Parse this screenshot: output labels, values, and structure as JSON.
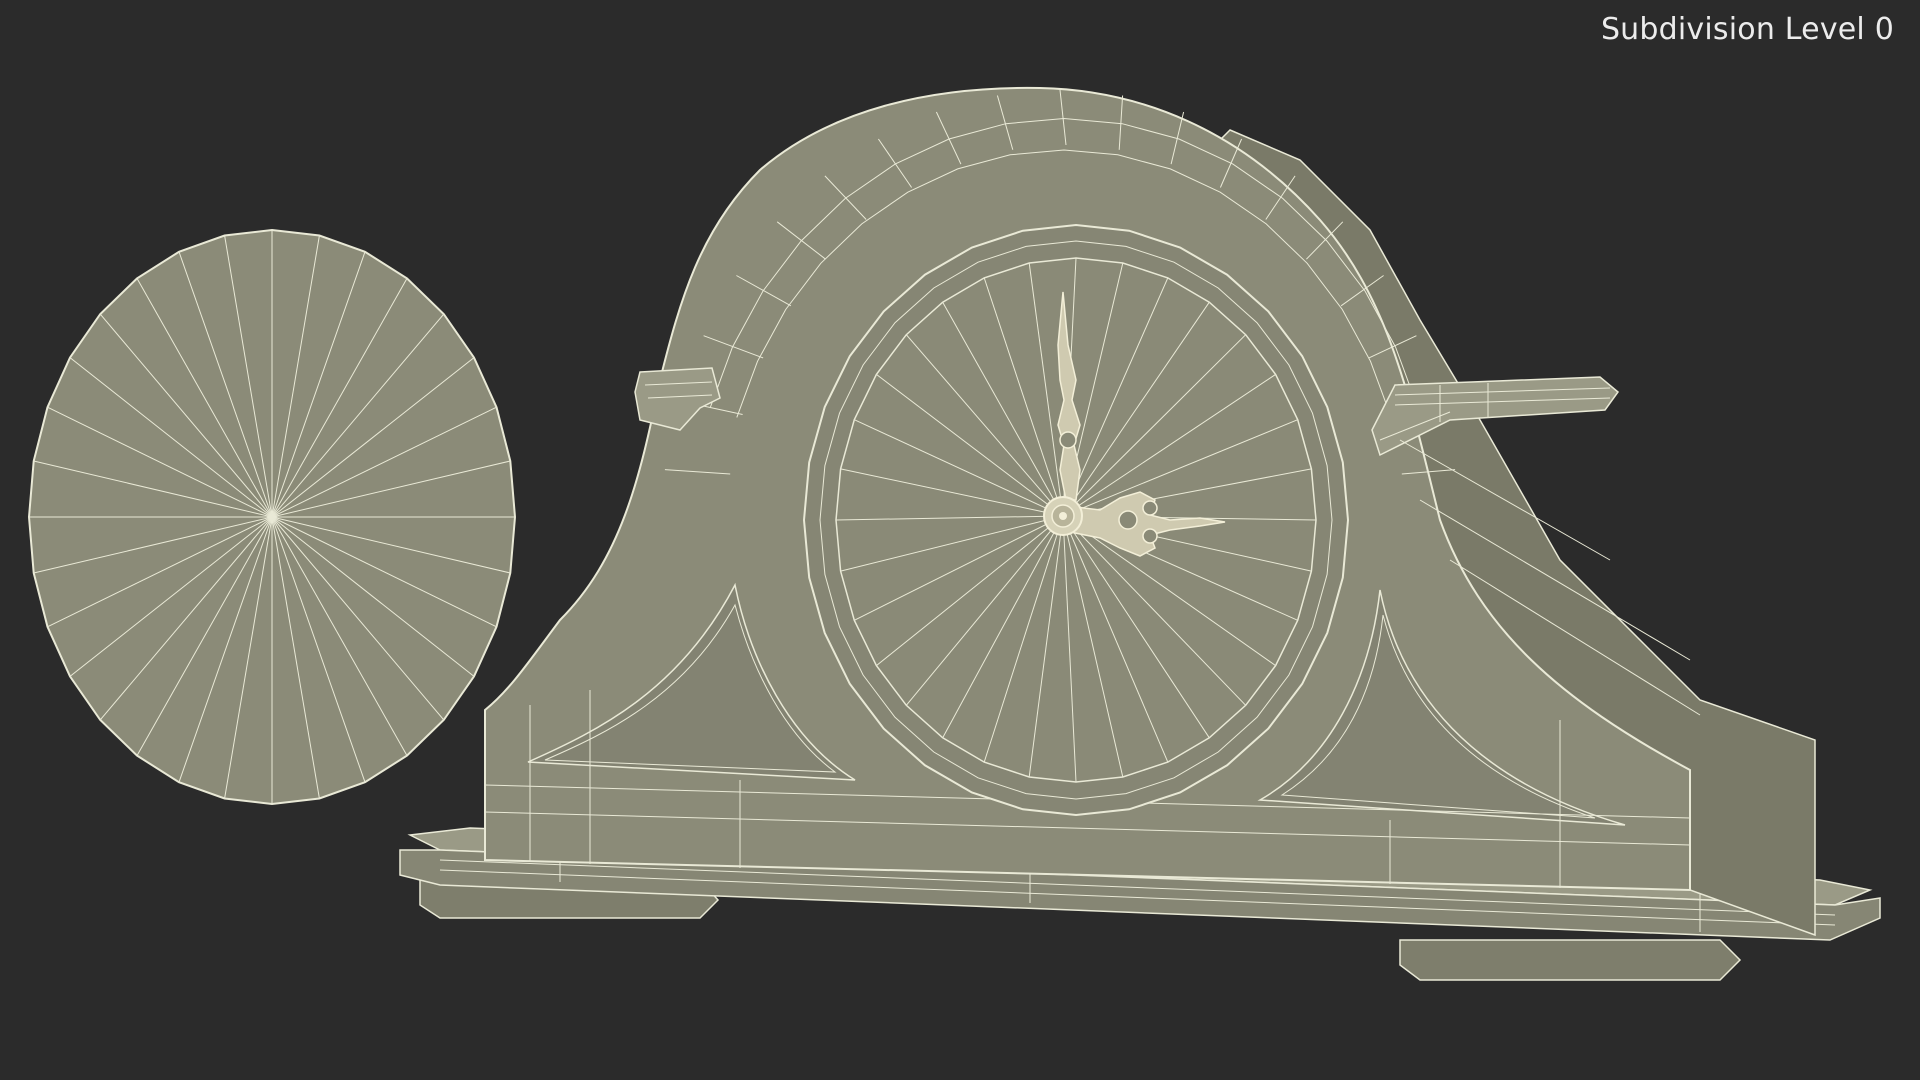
{
  "viewport": {
    "label": "Subdivision Level 0",
    "background_color": "#2b2b2b",
    "model_fill_color": "#8b8b78",
    "wire_color": "#e9e9d6",
    "hand_color": "#d6d2b8"
  },
  "scene": {
    "objects": [
      "pendulum-disc",
      "mantel-clock-body",
      "clock-face",
      "hour-hand",
      "minute-hand",
      "clock-base"
    ]
  }
}
